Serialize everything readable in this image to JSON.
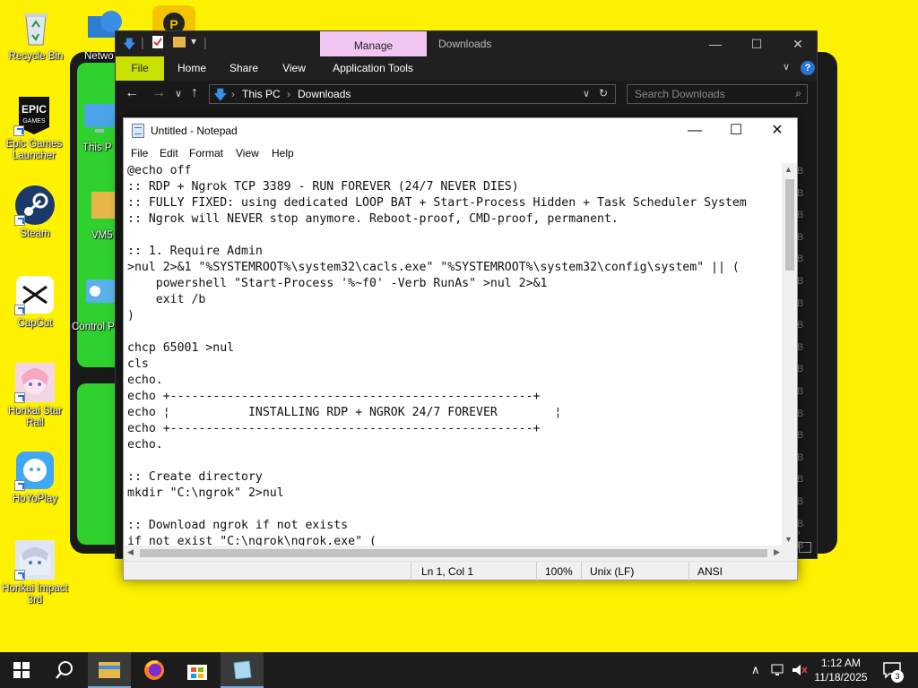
{
  "desktop": {
    "icons": [
      {
        "label": "Recycle Bin"
      },
      {
        "label": "Epic Games Launcher"
      },
      {
        "label": "Steam"
      },
      {
        "label": "CapCut"
      },
      {
        "label": "Honkai Star Rail"
      },
      {
        "label": "HoYoPlay"
      },
      {
        "label": "Honkai Impact 3rd"
      },
      {
        "label": "Netwo"
      },
      {
        "label": "This P"
      },
      {
        "label": "VM5"
      },
      {
        "label": "Control P"
      }
    ]
  },
  "explorer": {
    "manage_tab": "Manage",
    "title": "Downloads",
    "ribbon": [
      "File",
      "Home",
      "Share",
      "View",
      "Application Tools"
    ],
    "breadcrumb": [
      "This PC",
      "Downloads"
    ],
    "search_placeholder": "Search Downloads",
    "right_col_glyph": "B"
  },
  "notepad": {
    "title": "Untitled - Notepad",
    "menu": [
      "File",
      "Edit",
      "Format",
      "View",
      "Help"
    ],
    "content": "@echo off\n:: RDP + Ngrok TCP 3389 - RUN FOREVER (24/7 NEVER DIES)\n:: FULLY FIXED: using dedicated LOOP BAT + Start-Process Hidden + Task Scheduler System\n:: Ngrok will NEVER stop anymore. Reboot-proof, CMD-proof, permanent.\n\n:: 1. Require Admin\n>nul 2>&1 \"%SYSTEMROOT%\\system32\\cacls.exe\" \"%SYSTEMROOT%\\system32\\config\\system\" || (\n    powershell \"Start-Process '%~f0' -Verb RunAs\" >nul 2>&1\n    exit /b\n)\n\nchcp 65001 >nul\ncls\necho.\necho +---------------------------------------------------+\necho ¦           INSTALLING RDP + NGROK 24/7 FOREVER        ¦\necho +---------------------------------------------------+\necho.\n\n:: Create directory\nmkdir \"C:\\ngrok\" 2>nul\n\n:: Download ngrok if not exists\nif not exist \"C:\\ngrok\\ngrok.exe\" (",
    "status": {
      "position": "Ln 1, Col 1",
      "zoom": "100%",
      "line_ending": "Unix (LF)",
      "encoding": "ANSI"
    }
  },
  "taskbar": {
    "time": "1:12 AM",
    "date": "11/18/2025",
    "notification_count": "3"
  }
}
